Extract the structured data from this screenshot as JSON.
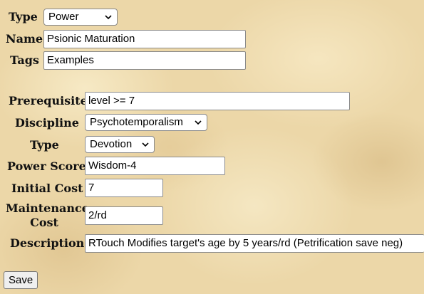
{
  "item": {
    "type_label": "Type",
    "type_value": "Power",
    "name_label": "Name",
    "name_value": "Psionic Maturation",
    "tags_label": "Tags",
    "tags_value": "Examples"
  },
  "power": {
    "prerequisite_label": "Prerequisite",
    "prerequisite_value": "level >= 7",
    "discipline_label": "Discipline",
    "discipline_value": "Psychotemporalism",
    "type_label": "Type",
    "type_value": "Devotion",
    "power_score_label": "Power Score",
    "power_score_value": "Wisdom-4",
    "initial_cost_label": "Initial Cost",
    "initial_cost_value": "7",
    "maintenance_cost_label_line1": "Maintenance",
    "maintenance_cost_label_line2": "Cost",
    "maintenance_cost_value": "2/rd",
    "description_label": "Description",
    "description_value": "RTouch Modifies target's age by 5 years/rd (Petrification save neg)"
  },
  "actions": {
    "save_label": "Save"
  }
}
